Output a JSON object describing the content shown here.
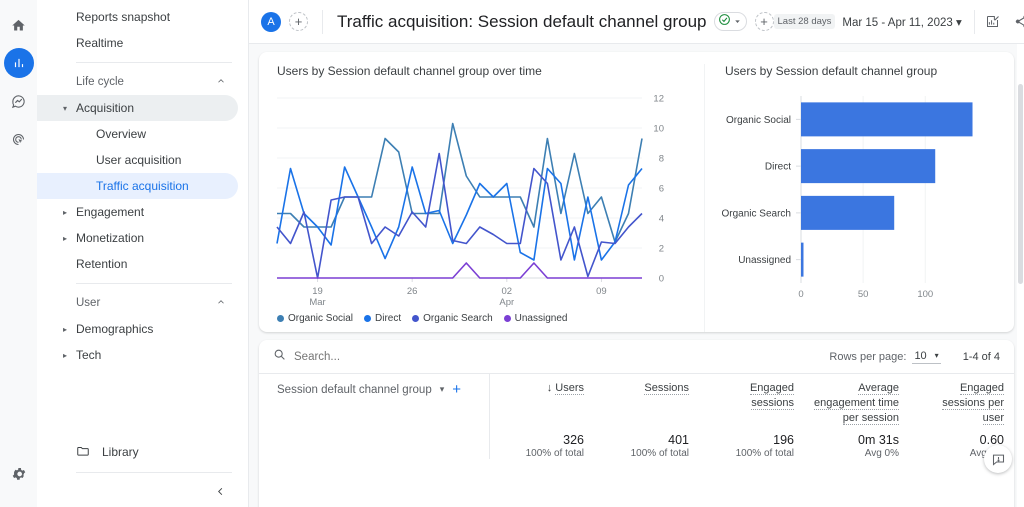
{
  "rail": {
    "items": [
      {
        "name": "home-icon",
        "label": "Home"
      },
      {
        "name": "reports-icon",
        "label": "Reports"
      },
      {
        "name": "explore-icon",
        "label": "Explore"
      },
      {
        "name": "advertising-icon",
        "label": "Advertising"
      }
    ],
    "settings_label": "Admin"
  },
  "sidebar": {
    "top_items": [
      {
        "label": "Reports snapshot"
      },
      {
        "label": "Realtime"
      }
    ],
    "sections": [
      {
        "label": "Life cycle",
        "items": [
          {
            "label": "Acquisition",
            "state": "expanded"
          },
          {
            "label": "Overview",
            "state": "sub"
          },
          {
            "label": "User acquisition",
            "state": "sub"
          },
          {
            "label": "Traffic acquisition",
            "state": "selected"
          },
          {
            "label": "Engagement",
            "state": "collapsed"
          },
          {
            "label": "Monetization",
            "state": "collapsed"
          },
          {
            "label": "Retention",
            "state": "plain"
          }
        ]
      },
      {
        "label": "User",
        "items": [
          {
            "label": "Demographics",
            "state": "collapsed"
          },
          {
            "label": "Tech",
            "state": "collapsed"
          }
        ]
      }
    ],
    "library_label": "Library",
    "collapse_label": "‹"
  },
  "topbar": {
    "avatar_initial": "A",
    "add_comparison_label": "+",
    "title": "Traffic acquisition: Session default channel group",
    "badge_check": "✓",
    "add_label": "+",
    "date_chip": "Last 28 days",
    "date_range": "Mar 15 - Apr 11, 2023",
    "icons": [
      {
        "name": "edit-comparisons-icon"
      },
      {
        "name": "share-icon"
      },
      {
        "name": "insights-icon"
      },
      {
        "name": "edit-pencil-icon"
      }
    ]
  },
  "line_card": {
    "title": "Users by Session default channel group over time"
  },
  "bar_card": {
    "title": "Users by Session default channel group"
  },
  "legend": [
    {
      "label": "Organic Social",
      "color": "#3d7fb3"
    },
    {
      "label": "Direct",
      "color": "#1a73e8"
    },
    {
      "label": "Organic Search",
      "color": "#4355cc"
    },
    {
      "label": "Unassigned",
      "color": "#7b3fd4"
    }
  ],
  "table_controls": {
    "search_placeholder": "Search...",
    "search_value": "",
    "rows_per_page_label": "Rows per page:",
    "rows_per_page_value": "10",
    "range_label": "1-4 of 4"
  },
  "table": {
    "dimension_label": "Session default channel group",
    "add_dimension_label": "+",
    "columns": [
      {
        "label": "Users",
        "sorted": true,
        "sort_glyph": "↓"
      },
      {
        "label": "Sessions",
        "sorted": false
      },
      {
        "label": "Engaged sessions",
        "sorted": false
      },
      {
        "label": "Average engagement time per session",
        "sorted": false
      },
      {
        "label": "Engaged sessions per user",
        "sorted": false
      }
    ],
    "totals_row": [
      {
        "value": "326",
        "sub": "100% of total"
      },
      {
        "value": "401",
        "sub": "100% of total"
      },
      {
        "value": "196",
        "sub": "100% of total"
      },
      {
        "value": "0m 31s",
        "sub": "Avg 0%"
      },
      {
        "value": "0.60",
        "sub": "Avg 0%"
      }
    ]
  },
  "feedback": {
    "name": "feedback-icon",
    "label": "Send feedback"
  },
  "chart_data": [
    {
      "type": "line",
      "title": "Users by Session default channel group over time",
      "xlabel": "",
      "ylabel": "Users",
      "ylim": [
        0,
        12
      ],
      "yticks": [
        0,
        2,
        4,
        6,
        8,
        10,
        12
      ],
      "grid": true,
      "legend_position": "bottom",
      "xticks": [
        {
          "pos": 3,
          "label": "19",
          "sublabel": "Mar"
        },
        {
          "pos": 10,
          "label": "26",
          "sublabel": ""
        },
        {
          "pos": 17,
          "label": "02",
          "sublabel": "Apr"
        },
        {
          "pos": 24,
          "label": "09",
          "sublabel": ""
        }
      ],
      "x": [
        "Mar 15",
        "Mar 16",
        "Mar 17",
        "Mar 18",
        "Mar 19",
        "Mar 20",
        "Mar 21",
        "Mar 22",
        "Mar 23",
        "Mar 24",
        "Mar 25",
        "Mar 26",
        "Mar 27",
        "Mar 28",
        "Mar 29",
        "Mar 30",
        "Mar 31",
        "Apr 01",
        "Apr 02",
        "Apr 03",
        "Apr 04",
        "Apr 05",
        "Apr 06",
        "Apr 07",
        "Apr 08",
        "Apr 09",
        "Apr 10",
        "Apr 11"
      ],
      "series": [
        {
          "name": "Organic Social",
          "color": "#3d7fb3",
          "values": [
            4.3,
            4.3,
            3.4,
            3.4,
            3.4,
            5.4,
            5.4,
            5.4,
            9.3,
            8.4,
            4.3,
            4.3,
            4.3,
            10.3,
            6.8,
            5.4,
            5.4,
            5.4,
            5.4,
            3.4,
            9.3,
            4.3,
            8.3,
            4.3,
            5.4,
            2.4,
            4.3,
            9.3
          ]
        },
        {
          "name": "Direct",
          "color": "#1a73e8",
          "values": [
            2.3,
            7.3,
            4.3,
            3.4,
            2.2,
            7.4,
            5.4,
            3.4,
            1.3,
            3.4,
            7.4,
            4.3,
            4.5,
            2.3,
            4.2,
            6.3,
            5.4,
            6.3,
            1.7,
            1.2,
            7.3,
            6.3,
            1.2,
            5.4,
            1.2,
            2.4,
            6.2,
            7.3
          ]
        },
        {
          "name": "Organic Search",
          "color": "#4355cc",
          "values": [
            3.4,
            2.3,
            4.4,
            0.0,
            5.2,
            5.4,
            5.4,
            2.3,
            3.4,
            2.8,
            4.4,
            3.4,
            8.3,
            2.5,
            2.3,
            3.4,
            2.9,
            2.3,
            2.3,
            7.3,
            6.3,
            1.2,
            3.4,
            0.1,
            2.4,
            2.3,
            3.4,
            4.3
          ]
        },
        {
          "name": "Unassigned",
          "color": "#7b3fd4",
          "values": [
            0,
            0,
            0,
            0,
            0,
            0,
            0,
            0,
            0,
            0,
            0,
            0,
            0,
            0,
            1,
            0,
            0,
            0,
            0,
            1,
            0,
            0,
            0,
            0,
            0,
            0,
            0,
            0
          ]
        }
      ]
    },
    {
      "type": "bar",
      "orientation": "horizontal",
      "title": "Users by Session default channel group",
      "xlabel": "",
      "ylabel": "",
      "xlim": [
        0,
        140
      ],
      "xticks": [
        0,
        50,
        100
      ],
      "grid": true,
      "bar_color": "#3b76e0",
      "categories": [
        "Organic Social",
        "Direct",
        "Organic Search",
        "Unassigned"
      ],
      "values": [
        138,
        108,
        75,
        2
      ]
    }
  ]
}
